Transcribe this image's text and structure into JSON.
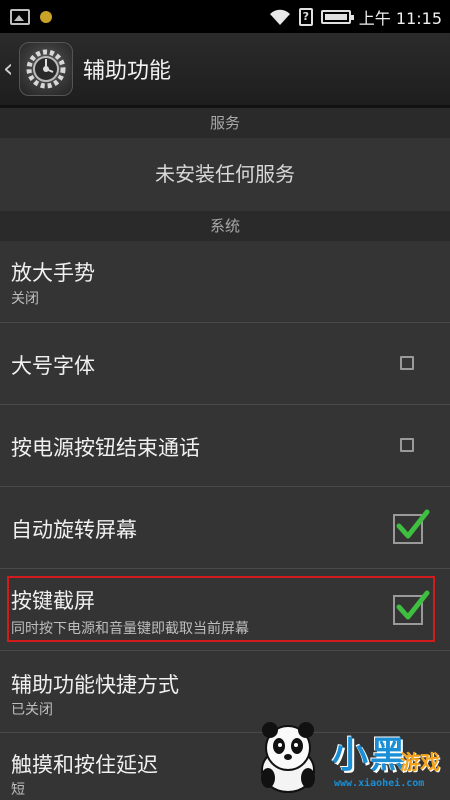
{
  "status_bar": {
    "time": "上午 11:15",
    "icons": [
      "image-icon",
      "notification-dot-icon",
      "wifi-icon",
      "sim-icon",
      "battery-icon"
    ]
  },
  "action_bar": {
    "back_glyph": "‹",
    "title": "辅助功能",
    "app_icon": "settings-gear-icon"
  },
  "sections": {
    "services": {
      "header": "服务",
      "empty_message": "未安装任何服务"
    },
    "system": {
      "header": "系统"
    }
  },
  "prefs": [
    {
      "title": "放大手势",
      "summary": "关闭"
    },
    {
      "title": "大号字体",
      "checked": false
    },
    {
      "title": "按电源按钮结束通话",
      "checked": false
    },
    {
      "title": "自动旋转屏幕",
      "checked": true
    },
    {
      "title": "按键截屏",
      "summary": "同时按下电源和音量键即截取当前屏幕",
      "checked": true
    },
    {
      "title": "辅助功能快捷方式",
      "summary": "已关闭"
    },
    {
      "title": "触摸和按住延迟",
      "summary": "短"
    }
  ],
  "watermark": {
    "brand": "小黑",
    "brand2": "游戏",
    "url": "www.xiaohei.com"
  },
  "colors": {
    "highlight_border": "#d21c1c",
    "check": "#3fbf3f",
    "background": "#343434"
  }
}
